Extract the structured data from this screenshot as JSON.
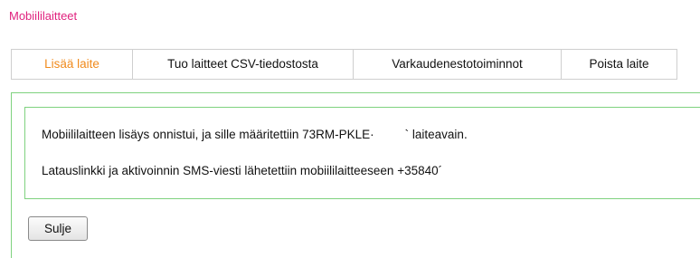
{
  "header": {
    "title": "Mobiililaitteet"
  },
  "tabs": [
    {
      "label": "Lisää laite",
      "active": true
    },
    {
      "label": "Tuo laitteet CSV-tiedostosta",
      "active": false
    },
    {
      "label": "Varkaudenestotoiminnot",
      "active": false
    },
    {
      "label": "Poista laite",
      "active": false
    }
  ],
  "message": {
    "line1_prefix": "Mobiililaitteen lisäys onnistui, ja sille määritettiin 73RM-PKLE·",
    "line1_suffix": "` laiteavain.",
    "line2": "Latauslinkki ja aktivoinnin SMS-viesti lähetettiin mobiililaitteeseen +35840´"
  },
  "actions": {
    "close_label": "Sulje"
  },
  "colors": {
    "title": "#e0227e",
    "active_tab": "#f08a1c",
    "panel_border": "#7fd27f",
    "tab_border": "#cfcfcf"
  }
}
